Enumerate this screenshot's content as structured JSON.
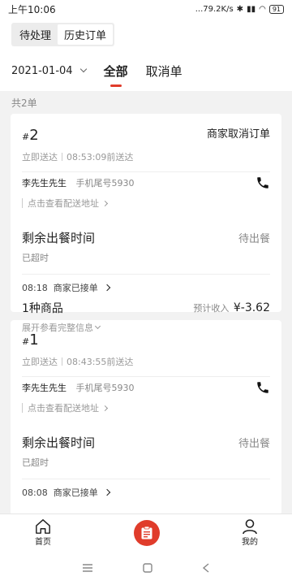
{
  "status_bar": {
    "time": "上午10:06",
    "net_speed": "...79.2K/s",
    "battery": "91"
  },
  "segment": {
    "items": [
      "待处理",
      "历史订单"
    ]
  },
  "filter": {
    "date": "2021-01-04",
    "tabs": [
      "全部",
      "取消单"
    ]
  },
  "count_text": "共2单",
  "orders": [
    {
      "number": "2",
      "status": "商家取消订单",
      "delivery_type": "立即送达",
      "deliver_by": "08:53:09前送达",
      "customer": "李先生先生",
      "phone_tail": "手机尾号5930",
      "address_link": "点击查看配送地址",
      "meal_title": "剩余出餐时间",
      "meal_state": "待出餐",
      "overdue": "已超时",
      "accepted": "08:18  商家已接单",
      "goods": "1种商品",
      "income_label": "预计收入",
      "income_amount": "¥-3.62",
      "expand": "展开参看完整信息"
    },
    {
      "number": "1",
      "delivery_type": "立即送达",
      "deliver_by": "08:43:55前送达",
      "customer": "李先生先生",
      "phone_tail": "手机尾号5930",
      "address_link": "点击查看配送地址",
      "meal_title": "剩余出餐时间",
      "meal_state": "待出餐",
      "overdue": "已超时",
      "accepted": "08:08  商家已接单"
    }
  ],
  "bottom_nav": {
    "home": "首页",
    "mine": "我的"
  },
  "colors": {
    "accent": "#e03c2b"
  }
}
